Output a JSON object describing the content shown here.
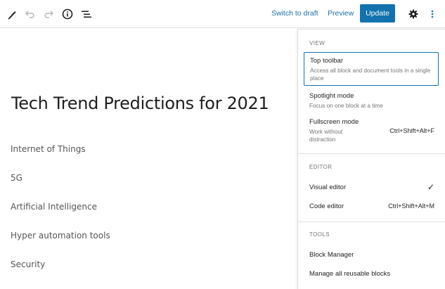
{
  "toolbar": {
    "switch_to_draft": "Switch to draft",
    "preview": "Preview",
    "update": "Update",
    "icons": [
      "pen-icon",
      "undo-icon",
      "redo-icon",
      "info-icon",
      "list-view-icon",
      "gear-icon",
      "kebab-icon"
    ]
  },
  "post": {
    "title": "Tech Trend Predictions for 2021",
    "paragraphs": [
      "Internet of Things",
      "5G",
      "Artificial Intelligence",
      "Hyper automation tools",
      "Security"
    ]
  },
  "menu": {
    "view": {
      "heading": "VIEW",
      "items": [
        {
          "label": "Top toolbar",
          "desc": "Access all block and document tools in a single place",
          "shortcut": ""
        },
        {
          "label": "Spotlight mode",
          "desc": "Focus on one block at a time",
          "shortcut": ""
        },
        {
          "label": "Fullscreen mode",
          "desc": "Work without distraction",
          "shortcut": "Ctrl+Shift+Alt+F"
        }
      ]
    },
    "editor": {
      "heading": "EDITOR",
      "items": [
        {
          "label": "Visual editor",
          "shortcut": "",
          "checked": true
        },
        {
          "label": "Code editor",
          "shortcut": "Ctrl+Shift+Alt+M"
        }
      ]
    },
    "tools": {
      "heading": "TOOLS",
      "items": [
        {
          "label": "Block Manager"
        },
        {
          "label": "Manage all reusable blocks"
        }
      ]
    }
  },
  "colors": {
    "accent": "#1172ae",
    "link": "#1e6fa8"
  }
}
